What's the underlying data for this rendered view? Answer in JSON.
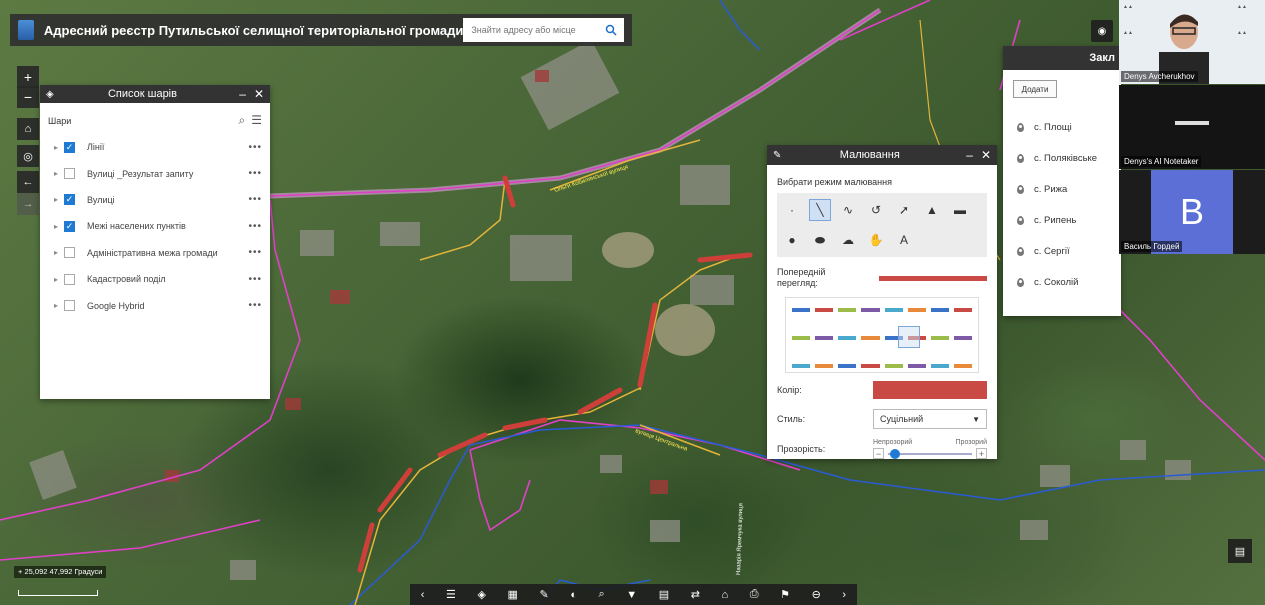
{
  "header": {
    "title": "Адресний реєстр Путильської селищної територіальної громади",
    "search_placeholder": "Знайти адресу або місце"
  },
  "map_tools": {
    "zoom_in": "+",
    "zoom_out": "−"
  },
  "layer_list": {
    "title": "Список шарів",
    "subtitle": "Шари",
    "layers": [
      {
        "label": "Лінії",
        "checked": true
      },
      {
        "label": "Вулиці _Результат запиту",
        "checked": false
      },
      {
        "label": "Вулиці",
        "checked": true
      },
      {
        "label": "Межі населених пунктів",
        "checked": true
      },
      {
        "label": "Адміністративна межа громади",
        "checked": false
      },
      {
        "label": "Кадастровий поділ",
        "checked": false
      },
      {
        "label": "Google Hybrid",
        "checked": false
      }
    ]
  },
  "drawing": {
    "title": "Малювання",
    "mode_label": "Вибрати режим малювання",
    "preview_label": "Попередній перегляд:",
    "color_label": "Колір:",
    "style_label": "Стиль:",
    "style_value": "Суцільний",
    "opacity_label": "Прозорість:",
    "opacity_min": "Непрозорий",
    "opacity_max": "Прозорий",
    "line_color": "#c94a45"
  },
  "settlements": {
    "title": "Закл",
    "add_button": "Додати",
    "items": [
      "с. Площі",
      "с. Поляківське",
      "с. Рижа",
      "с. Рипень",
      "с. Сергії",
      "с. Соколій"
    ]
  },
  "video": {
    "participant1": "Denys Avcherukhov",
    "participant2": "Denys's AI Notetaker",
    "participant3": "Василь Гордей",
    "avatar_letter": "B"
  },
  "status": {
    "coordinates": "25,092 47,992 Градуси"
  },
  "map_labels": {
    "street1": "вулиця Центральна",
    "street2": "Ольги Кобилянської вулиця",
    "street3": "Назарія Яремчука вулиця"
  }
}
